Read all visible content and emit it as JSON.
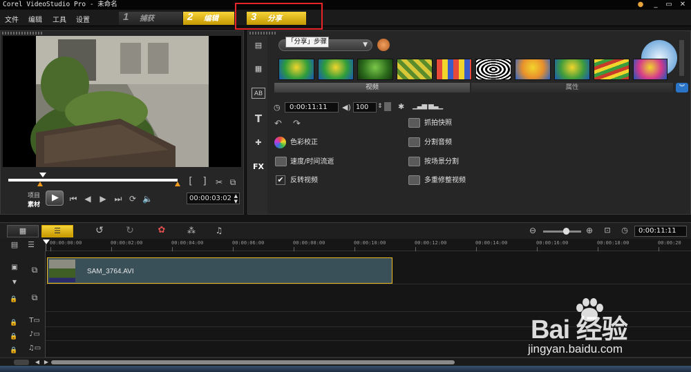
{
  "window": {
    "title": "Corel VideoStudio Pro - 未命名",
    "buttons": [
      "●",
      "_",
      "▭",
      "✕"
    ]
  },
  "menu": [
    "文件",
    "编辑",
    "工具",
    "设置"
  ],
  "steps": [
    {
      "num": "1",
      "label": "捕获"
    },
    {
      "num": "2",
      "label": "编辑"
    },
    {
      "num": "3",
      "label": "分享"
    }
  ],
  "preview": {
    "mode_labels": [
      "项目",
      "素材"
    ],
    "timecode": "00:00:03:02",
    "trim_buttons": [
      "[",
      "]"
    ]
  },
  "library": {
    "tooltip": "「分享」步骤",
    "tabs": [
      "视频",
      "属性"
    ],
    "duration": "0:00:11:11",
    "volume": "100",
    "options_left": [
      "色彩校正",
      "速度/时间流逝",
      "反转视频"
    ],
    "options_right": [
      "抓拍快照",
      "分割音频",
      "按场景分割",
      "多重修整视频"
    ],
    "reverse_checked": true
  },
  "timeline": {
    "project_duration": "0:00:11:11",
    "ruler_labels": [
      "00:00:00:00",
      "00:00:02:00",
      "00:00:04:00",
      "00:00:06:00",
      "00:00:08:00",
      "00:00:10:00",
      "00:00:12:00",
      "00:00:14:00",
      "00:00:16:00",
      "00:00:18:00",
      "00:00:20"
    ],
    "clip_name": "SAM_3764.AVI"
  },
  "watermark": {
    "brand": "Bai 经验",
    "url": "jingyan.baidu.com"
  },
  "colors": {
    "accent": "#f2b820",
    "highlight": "#e8262a",
    "bg": "#141414"
  }
}
